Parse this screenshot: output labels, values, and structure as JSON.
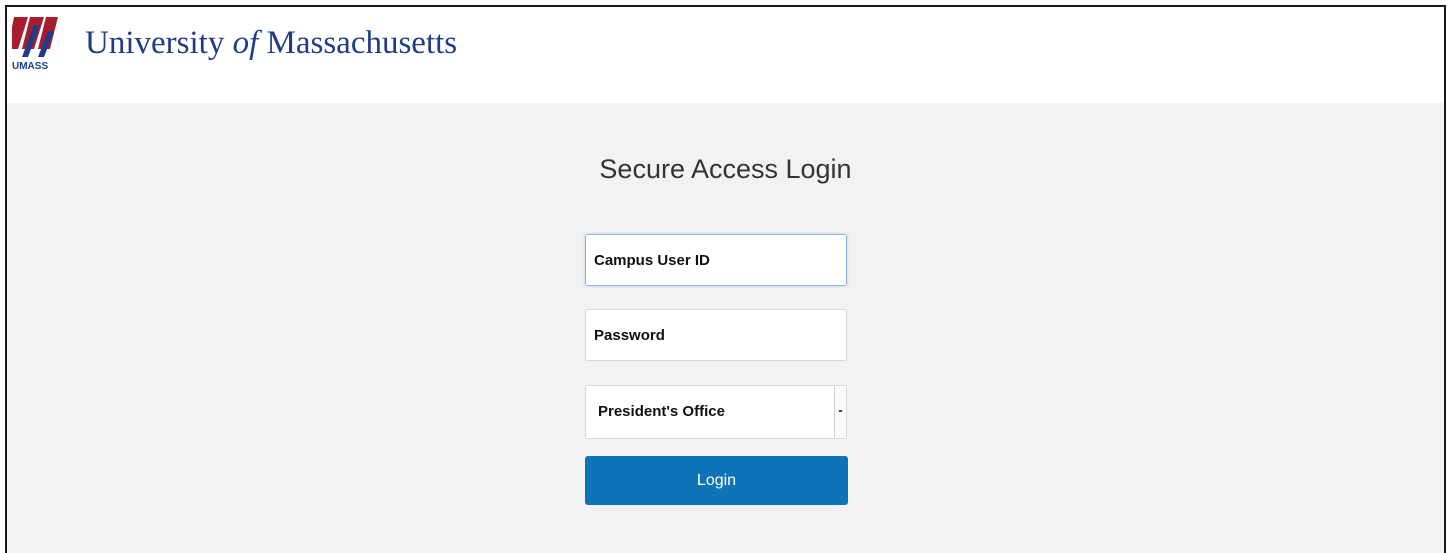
{
  "header": {
    "logo_word": "UMASS",
    "brand_pre": "University ",
    "brand_of": "of",
    "brand_post": " Massachusetts"
  },
  "login": {
    "title": "Secure Access Login",
    "user_id_placeholder": "Campus User ID",
    "password_placeholder": "Password",
    "campus_selected": "President's Office",
    "button_label": "Login"
  },
  "colors": {
    "brand_blue": "#1f3c88",
    "brand_red": "#a81c2e",
    "button_blue": "#0f73b8",
    "page_bg": "#f2f2f2"
  },
  "icons": {
    "logo": "umass-logo-icon",
    "select_arrow": "chevron-down-icon"
  }
}
